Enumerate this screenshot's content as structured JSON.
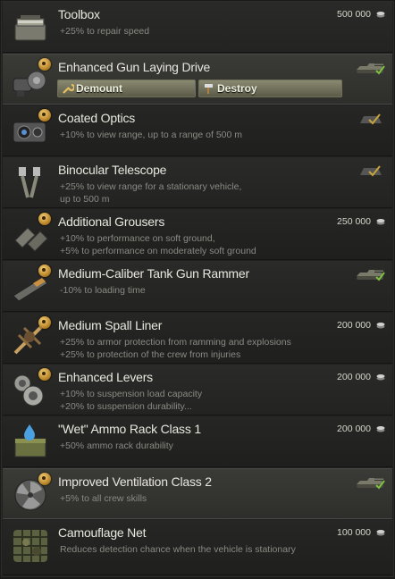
{
  "modules": [
    {
      "title": "Toolbox",
      "desc": [
        "+25% to repair speed"
      ],
      "price": "500 000"
    },
    {
      "title": "Enhanced Gun Laying Drive",
      "desc": [],
      "buttons": {
        "demount": "Demount",
        "destroy": "Destroy"
      }
    },
    {
      "title": "Coated Optics",
      "desc": [
        "+10% to view range, up to a range of 500 m"
      ]
    },
    {
      "title": "Binocular Telescope",
      "desc": [
        "+25% to view range for a stationary vehicle,",
        "up to 500 m"
      ]
    },
    {
      "title": "Additional Grousers",
      "desc": [
        "+10% to performance on soft ground,",
        "+5% to performance on moderately soft ground"
      ],
      "price": "250 000"
    },
    {
      "title": "Medium-Caliber Tank Gun Rammer",
      "desc": [
        "-10% to loading time"
      ]
    },
    {
      "title": "Medium Spall Liner",
      "desc": [
        "+25% to armor protection from ramming and explosions",
        "+25% to protection of the crew from injuries"
      ],
      "price": "200 000"
    },
    {
      "title": "Enhanced Levers",
      "desc": [
        "+10% to suspension load capacity",
        "+20% to suspension durability..."
      ],
      "price": "200 000"
    },
    {
      "title": "\"Wet\" Ammo Rack Class 1",
      "desc": [
        "+50% ammo rack durability"
      ],
      "price": "200 000"
    },
    {
      "title": "Improved Ventilation Class 2",
      "desc": [
        "+5% to all crew skills"
      ]
    },
    {
      "title": "Camouflage Net",
      "desc": [
        "Reduces detection chance when the vehicle is stationary"
      ],
      "price": "100 000"
    }
  ],
  "colors": {
    "accent_check": "#c8a43a",
    "installed_check": "#7ec040",
    "coin": "#c8c8c8"
  }
}
